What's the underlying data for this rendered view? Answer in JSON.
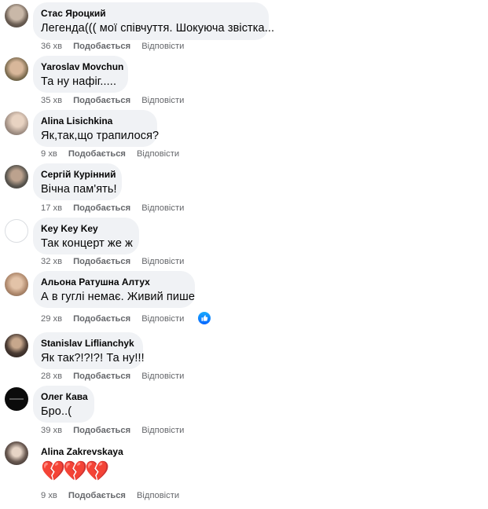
{
  "like_label": "Подобається",
  "reply_label": "Відповісти",
  "comments": [
    {
      "author": "Стас Яроцкий",
      "text": "Легенда((( мої співчуття. Шокуюча звістка...",
      "time": "36 хв"
    },
    {
      "author": "Yaroslav Movchun",
      "text": "Та ну нафіг.....",
      "time": "35 хв"
    },
    {
      "author": "Alina Lisichkina",
      "text": "Як,так,що трапилося?",
      "time": "9 хв"
    },
    {
      "author": "Сергій Курінний",
      "text": "Вічна пам'ять!",
      "time": "17 хв"
    },
    {
      "author": "Key Key Key",
      "text": "Так концерт же ж",
      "time": "32 хв"
    },
    {
      "author": "Альона Ратушна Алтух",
      "text": "А в гуглі немає. Живий пише",
      "time": "29 хв",
      "reaction": "like"
    },
    {
      "author": "Stanislav Liflianchyk",
      "text": "Як так?!?!?! Та ну!!!",
      "time": "28 хв"
    },
    {
      "author": "Олег Кава",
      "text": "Бро..(",
      "time": "39 хв"
    },
    {
      "author": "Alina Zakrevskaya",
      "text": "💔💔💔",
      "time": "9 хв"
    }
  ],
  "colors": {
    "bubble": "#f0f2f5",
    "meta": "#65676b",
    "like_reaction": "#0866ff"
  }
}
